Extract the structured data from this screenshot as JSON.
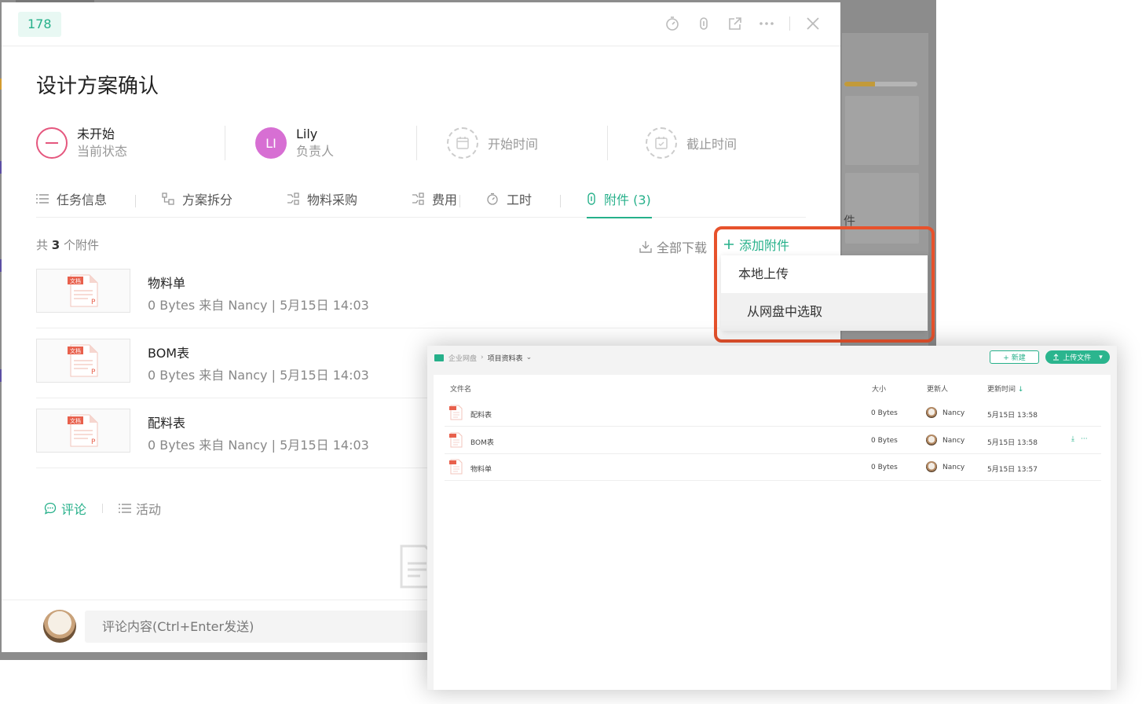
{
  "background": {
    "partial_label": "件",
    "progress_fraction": 0.42
  },
  "task": {
    "id": "178",
    "title": "设计方案确认",
    "status": {
      "value": "未开始",
      "label": "当前状态"
    },
    "owner": {
      "initials": "LI",
      "name": "Lily",
      "label": "负责人"
    },
    "start_time_placeholder": "开始时间",
    "due_time_placeholder": "截止时间",
    "tabs": [
      {
        "label": "任务信息",
        "icon": "list-icon"
      },
      {
        "label": "方案拆分",
        "icon": "split-icon"
      },
      {
        "label": "物料采购",
        "icon": "procure-icon"
      },
      {
        "label": "费用",
        "icon": "cost-icon"
      },
      {
        "label": "工时",
        "icon": "timer-icon"
      },
      {
        "label": "附件 (3)",
        "icon": "paperclip-icon",
        "active": true
      }
    ],
    "attachments_count_prefix": "共",
    "attachments_count": "3",
    "attachments_count_suffix": "个附件",
    "download_all": "全部下载",
    "add_attachment": "添加附件",
    "add_menu": [
      "本地上传",
      "从网盘中选取"
    ],
    "thumb_badge": "文档",
    "thumb_letter": "P",
    "attachments": [
      {
        "name": "物料单",
        "meta": "0 Bytes  来自 Nancy  |  5月15日 14:03"
      },
      {
        "name": "BOM表",
        "meta": "0 Bytes  来自 Nancy  |  5月15日 14:03"
      },
      {
        "name": "配料表",
        "meta": "0 Bytes  来自 Nancy  |  5月15日 14:03"
      }
    ],
    "bottom_tabs": {
      "comment": "评论",
      "activity": "活动"
    },
    "comment_placeholder": "评论内容(Ctrl+Enter发送)"
  },
  "drive": {
    "breadcrumb_root": "企业网盘",
    "breadcrumb_current": "项目资料表",
    "new_button": "+ 新建",
    "upload_button": "上传文件",
    "columns": {
      "name": "文件名",
      "size": "大小",
      "updater": "更新人",
      "updated": "更新时间"
    },
    "files": [
      {
        "name": "配料表",
        "size": "0 Bytes",
        "updater": "Nancy",
        "updated": "5月15日 13:58"
      },
      {
        "name": "BOM表",
        "size": "0 Bytes",
        "updater": "Nancy",
        "updated": "5月15日 13:58"
      },
      {
        "name": "物料单",
        "size": "0 Bytes",
        "updater": "Nancy",
        "updated": "5月15日 13:57"
      }
    ]
  },
  "colors": {
    "accent": "#26b08a",
    "highlight": "#e7522c",
    "status": "#e5577e",
    "avatar": "#d76fd3"
  }
}
